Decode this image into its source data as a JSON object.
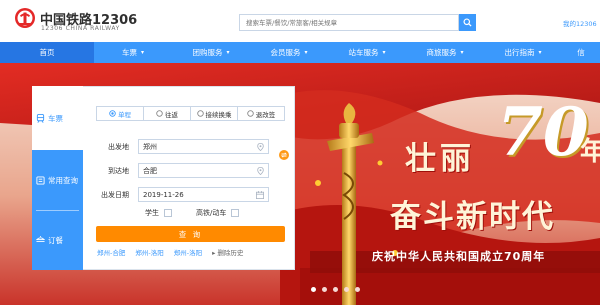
{
  "header": {
    "logo_cn": "中国铁路12306",
    "logo_en": "12306 CHINA RAILWAY",
    "search_placeholder": "搜索车票/餐饮/常旅客/相关规章",
    "user_link": "我的12306"
  },
  "nav": {
    "items": [
      {
        "label": "首页",
        "caret": ""
      },
      {
        "label": "车票",
        "caret": "▾"
      },
      {
        "label": "团购服务",
        "caret": "▾"
      },
      {
        "label": "会员服务",
        "caret": "▾"
      },
      {
        "label": "站车服务",
        "caret": "▾"
      },
      {
        "label": "商旅服务",
        "caret": "▾"
      },
      {
        "label": "出行指南",
        "caret": "▾"
      },
      {
        "label": "信",
        "caret": ""
      }
    ]
  },
  "side": {
    "items": [
      {
        "label": "车票"
      },
      {
        "label": "常用查询"
      },
      {
        "label": "订餐"
      }
    ]
  },
  "booking": {
    "tabs": [
      "单程",
      "往返",
      "接续换乘",
      "退改签"
    ],
    "from_label": "出发地",
    "from_value": "郑州",
    "to_label": "到达地",
    "to_value": "合肥",
    "date_label": "出发日期",
    "date_value": "2019-11-26",
    "student_label": "学生",
    "gaotie_label": "高铁/动车",
    "query_label": "查 询",
    "history": [
      "郑州-合肥",
      "郑州-洛阳",
      "郑州-洛阳"
    ],
    "delete_history": "删除历史"
  },
  "banner": {
    "line1": "壮丽",
    "seventy": "70",
    "nian": "年",
    "line2": "奋斗新时代",
    "subline": "庆祝中华人民共和国成立70周年"
  },
  "colors": {
    "primary": "#3b99fc",
    "nav_active": "#2676e3",
    "accent_orange": "#ff8a00",
    "banner_red": "#c61a16"
  }
}
